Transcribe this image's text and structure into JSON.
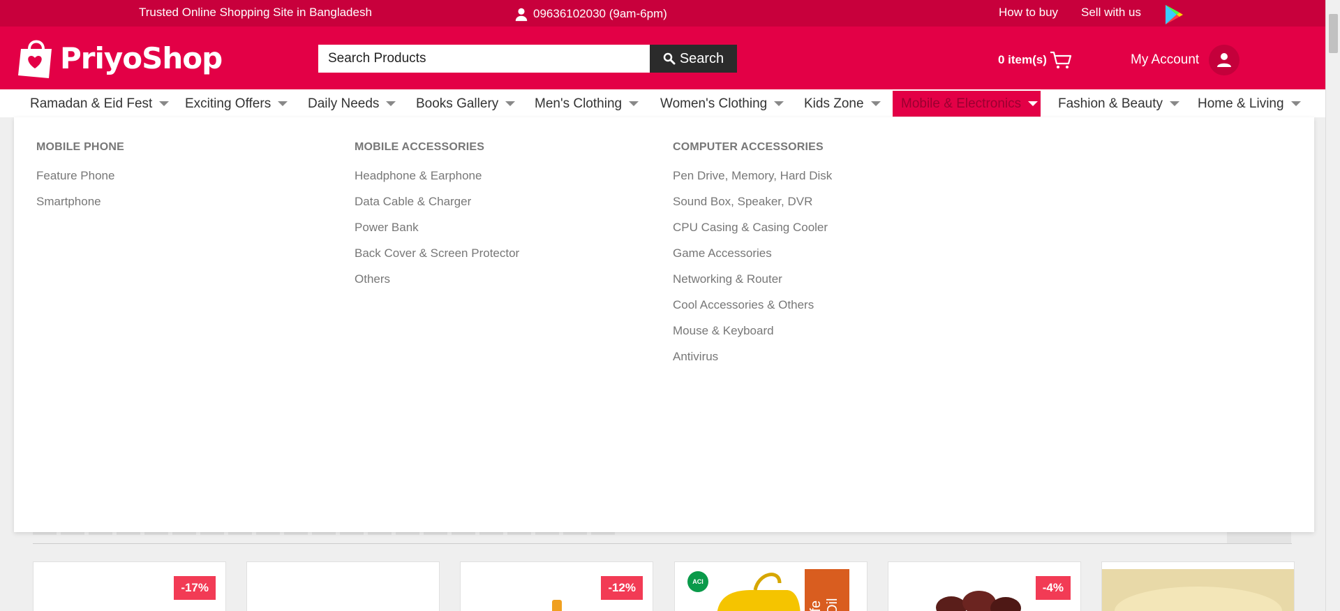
{
  "topbar": {
    "tagline": "Trusted Online Shopping Site in Bangladesh",
    "phone": "09636102030 (9am-6pm)",
    "how_to_buy": "How to buy",
    "sell_with_us": "Sell with us"
  },
  "header": {
    "logo_text": "PriyoShop",
    "search_placeholder": "Search Products",
    "search_button": "Search",
    "cart_label": "0 item(s)",
    "account_label": "My Account"
  },
  "nav": {
    "items": [
      {
        "label": "Ramadan & Eid Fest"
      },
      {
        "label": "Exciting Offers"
      },
      {
        "label": "Daily Needs"
      },
      {
        "label": "Books Gallery"
      },
      {
        "label": "Men's Clothing"
      },
      {
        "label": "Women's Clothing"
      },
      {
        "label": "Kids Zone"
      },
      {
        "label": "Mobile & Electronics",
        "active": true
      },
      {
        "label": "Fashion & Beauty"
      },
      {
        "label": "Home & Living"
      }
    ]
  },
  "dropdown": {
    "columns": [
      {
        "heading": "MOBILE PHONE",
        "items": [
          "Feature Phone",
          "Smartphone"
        ]
      },
      {
        "heading": "MOBILE ACCESSORIES",
        "items": [
          "Headphone & Earphone",
          "Data Cable & Charger",
          "Power Bank",
          "Back Cover & Screen Protector",
          "Others"
        ]
      },
      {
        "heading": "COMPUTER ACCESSORIES",
        "items": [
          "Pen Drive, Memory, Hard Disk",
          "Sound Box, Speaker, DVR",
          "CPU Casing & Casing Cooler",
          "Game Accessories",
          "Networking & Router",
          "Cool Accessories & Others",
          "Mouse & Keyboard",
          "Antivirus"
        ]
      }
    ]
  },
  "products": {
    "badges": [
      "-17%",
      "",
      "-12%",
      "",
      "-4%",
      ""
    ],
    "aci_logo_text": "ACI"
  },
  "colors": {
    "brand": "#e30046",
    "topbar": "#c8003c",
    "badge": "#f23b55",
    "search_button": "#2b2b2b"
  },
  "icons": [
    "user-headset-icon",
    "google-play-icon",
    "shopping-bag-logo-icon",
    "search-icon",
    "cart-icon",
    "user-icon",
    "caret-down-icon"
  ]
}
